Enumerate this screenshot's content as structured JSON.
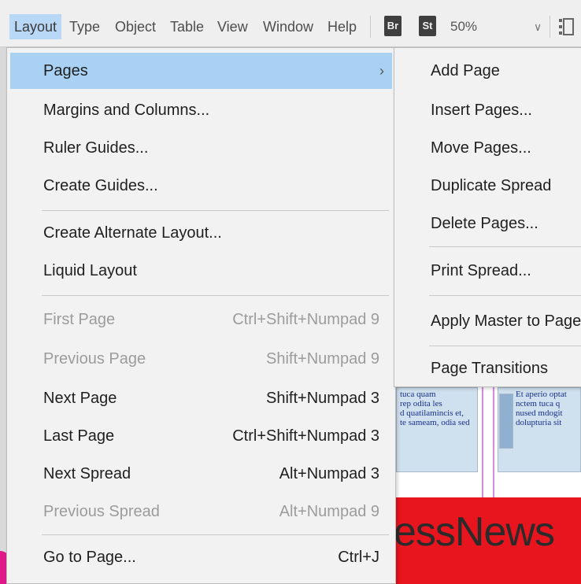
{
  "menubar": {
    "items": [
      "Layout",
      "Type",
      "Object",
      "Table",
      "View",
      "Window",
      "Help"
    ],
    "badges": [
      "Br",
      "St"
    ],
    "zoom": "50%"
  },
  "menu": {
    "items": [
      {
        "label": "Pages",
        "shortcut": "",
        "submenu": true,
        "highlighted": true
      },
      {
        "label": "Margins and Columns...",
        "shortcut": ""
      },
      {
        "label": "Ruler Guides...",
        "shortcut": ""
      },
      {
        "label": "Create Guides...",
        "shortcut": ""
      },
      {
        "label": "Create Alternate Layout...",
        "shortcut": ""
      },
      {
        "label": "Liquid Layout",
        "shortcut": ""
      },
      {
        "label": "First Page",
        "shortcut": "Ctrl+Shift+Numpad 9",
        "disabled": true
      },
      {
        "label": "Previous Page",
        "shortcut": "Shift+Numpad 9",
        "disabled": true
      },
      {
        "label": "Next Page",
        "shortcut": "Shift+Numpad 3"
      },
      {
        "label": "Last Page",
        "shortcut": "Ctrl+Shift+Numpad 3"
      },
      {
        "label": "Next Spread",
        "shortcut": "Alt+Numpad 3"
      },
      {
        "label": "Previous Spread",
        "shortcut": "Alt+Numpad 9",
        "disabled": true
      },
      {
        "label": "Go to Page...",
        "shortcut": "Ctrl+J"
      }
    ]
  },
  "submenu": {
    "items": [
      "Add Page",
      "Insert Pages...",
      "Move Pages...",
      "Duplicate Spread",
      "Delete Pages...",
      "Print Spread...",
      "Apply Master to Pages...",
      "Page Transitions"
    ]
  },
  "document": {
    "frame_texts": [
      "tuca quam\nrep odita les\nd quatilamincis et,\nte sameam, odia sed",
      "Et aperio optat\nnctem tuca q\nnused mdogit\ndolupturia sit"
    ],
    "headline": "essNews"
  },
  "colors": {
    "highlight": "#a9d1f4",
    "menu_bg": "#f2f2f2",
    "headline_band": "#e8141e",
    "guide": "#d68ae0"
  }
}
